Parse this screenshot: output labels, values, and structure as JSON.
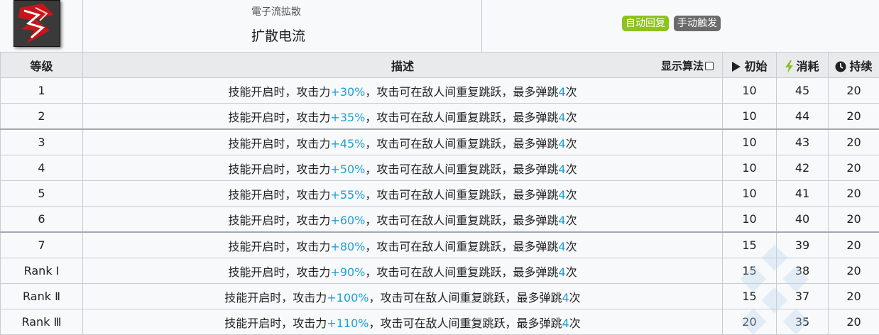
{
  "skill": {
    "icon": "electric-skill-icon",
    "subtitle": "電子流拡散",
    "name": "扩散电流",
    "tags": [
      {
        "label": "自动回复",
        "color": "#8ec31f"
      },
      {
        "label": "手动触发",
        "color": "#6b6b6b"
      }
    ]
  },
  "table": {
    "headers": {
      "level": "等级",
      "desc": "描述",
      "show_formula": "显示算法",
      "initial": "初始",
      "cost": "消耗",
      "duration": "持续"
    },
    "desc_prefix": "技能开启时，攻击力",
    "desc_middle": "，攻击可在敌人间重复跳跃，最多弹跳",
    "desc_bounces": "4",
    "desc_suffix": "次",
    "rows": [
      {
        "level": "1",
        "atk": "+30%",
        "initial": "10",
        "cost": "45",
        "duration": "20"
      },
      {
        "level": "2",
        "atk": "+35%",
        "initial": "10",
        "cost": "44",
        "duration": "20"
      },
      {
        "level": "3",
        "atk": "+45%",
        "initial": "10",
        "cost": "43",
        "duration": "20"
      },
      {
        "level": "4",
        "atk": "+50%",
        "initial": "10",
        "cost": "42",
        "duration": "20"
      },
      {
        "level": "5",
        "atk": "+55%",
        "initial": "10",
        "cost": "41",
        "duration": "20"
      },
      {
        "level": "6",
        "atk": "+60%",
        "initial": "10",
        "cost": "40",
        "duration": "20"
      },
      {
        "level": "7",
        "atk": "+80%",
        "initial": "15",
        "cost": "39",
        "duration": "20"
      },
      {
        "level": "Rank Ⅰ",
        "atk": "+90%",
        "initial": "15",
        "cost": "38",
        "duration": "20"
      },
      {
        "level": "Rank Ⅱ",
        "atk": "+100%",
        "initial": "15",
        "cost": "37",
        "duration": "20"
      },
      {
        "level": "Rank Ⅲ",
        "atk": "+110%",
        "initial": "20",
        "cost": "35",
        "duration": "20"
      }
    ]
  },
  "colors": {
    "highlight": "#1ea0d8",
    "cost_icon": "#8ec31f"
  }
}
